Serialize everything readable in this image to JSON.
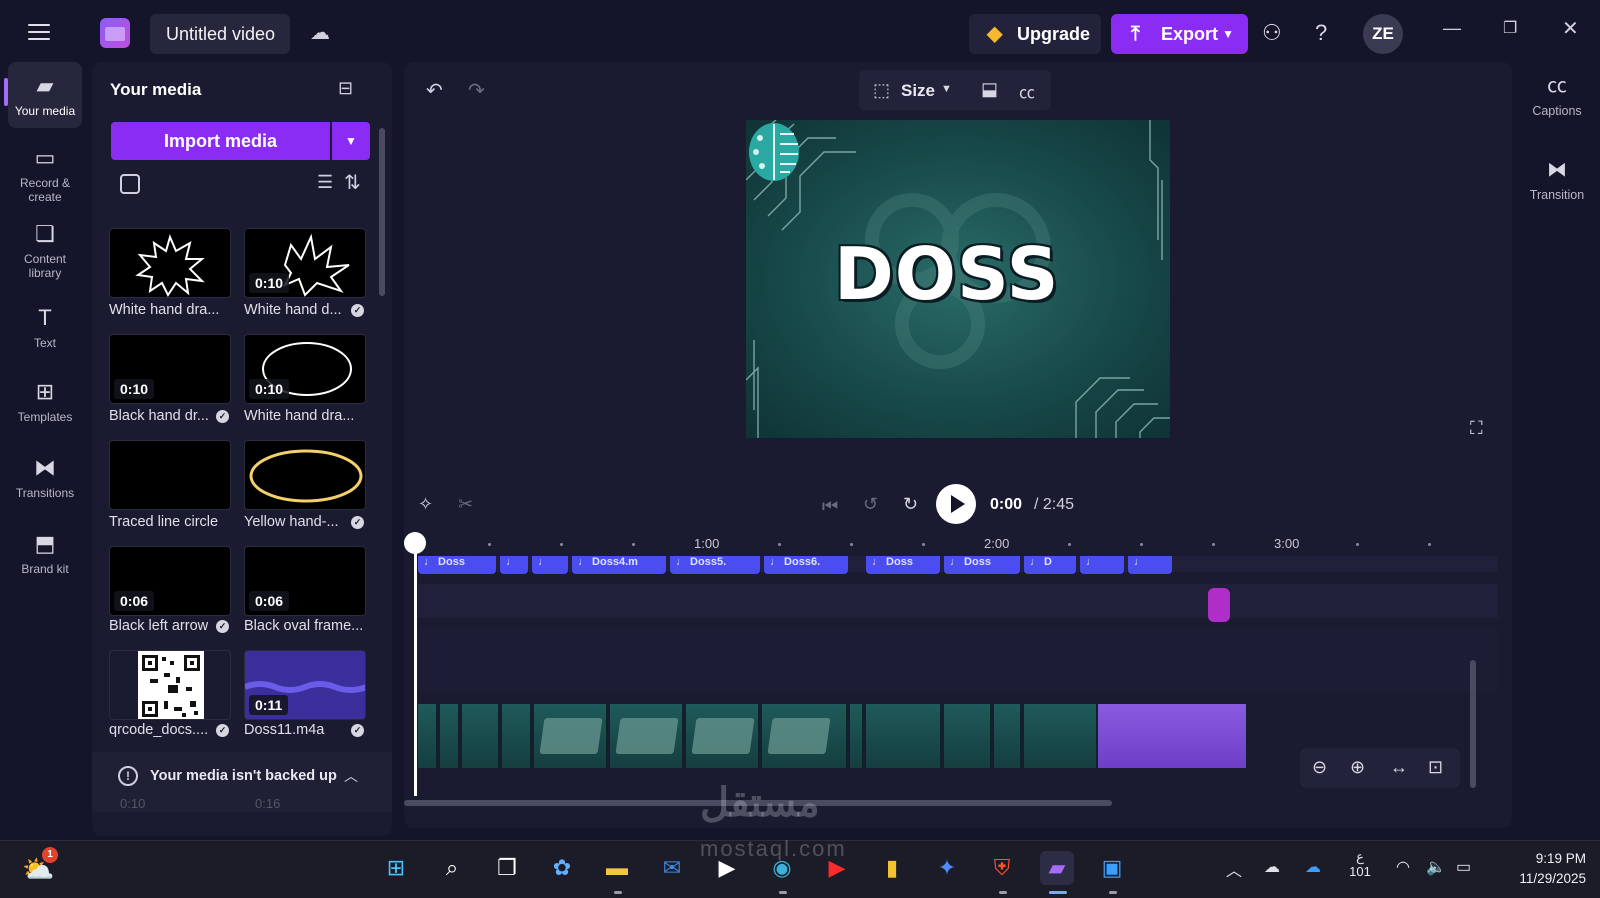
{
  "header": {
    "title": "Untitled video",
    "upgrade_label": "Upgrade",
    "export_label": "Export",
    "avatar_initials": "ZE",
    "accent_color": "#8b2cf5"
  },
  "left_nav": {
    "items": [
      {
        "label": "Your media",
        "icon": "folder-icon",
        "active": true
      },
      {
        "label": "Record & create",
        "icon": "camera-icon"
      },
      {
        "label": "Content library",
        "icon": "library-icon"
      },
      {
        "label": "Text",
        "icon": "text-icon"
      },
      {
        "label": "Templates",
        "icon": "templates-icon"
      },
      {
        "label": "Transitions",
        "icon": "transitions-icon"
      },
      {
        "label": "Brand kit",
        "icon": "brand-kit-icon"
      }
    ]
  },
  "media_panel": {
    "title": "Your media",
    "import_label": "Import media",
    "items": [
      {
        "label": "White hand dra...",
        "duration": "",
        "checked": false
      },
      {
        "label": "White hand d...",
        "duration": "0:10",
        "checked": true
      },
      {
        "label": "Black hand dr...",
        "duration": "0:10",
        "checked": true
      },
      {
        "label": "White hand dra...",
        "duration": "0:10",
        "checked": false
      },
      {
        "label": "Traced line circle",
        "duration": "",
        "checked": false
      },
      {
        "label": "Yellow hand-...",
        "duration": "",
        "checked": true
      },
      {
        "label": "Black left arrow",
        "duration": "0:06",
        "checked": true
      },
      {
        "label": "Black oval frame...",
        "duration": "0:06",
        "checked": false
      },
      {
        "label": "qrcode_docs....",
        "duration": "",
        "checked": true
      },
      {
        "label": "Doss11.m4a",
        "duration": "0:11",
        "checked": true
      }
    ],
    "backup_notice": "Your media isn't backed up",
    "hidden_durations": [
      "0:10",
      "0:16"
    ]
  },
  "editor": {
    "size_label": "Size",
    "preview_title": "DOSS",
    "current_time": "0:00",
    "total_time": "/ 2:45"
  },
  "timeline": {
    "ruler": [
      "1:00",
      "2:00",
      "3:00"
    ],
    "audio_clips": [
      {
        "label": "♩ Doss"
      },
      {
        "label": "♩"
      },
      {
        "label": "♩"
      },
      {
        "label": "♩ Doss4.m"
      },
      {
        "label": "♩ Doss5."
      },
      {
        "label": "♩ Doss6."
      },
      {
        "label": "♩ Doss"
      },
      {
        "label": "♩ Doss"
      },
      {
        "label": "♩ D"
      },
      {
        "label": "♩"
      },
      {
        "label": "♩"
      }
    ]
  },
  "right_rail": {
    "items": [
      {
        "label": "Captions",
        "icon": "captions-icon"
      },
      {
        "label": "Transition",
        "icon": "transition-icon"
      }
    ]
  },
  "taskbar": {
    "notification_count": "1",
    "language": "ع",
    "language_sub": "101",
    "time": "9:19 PM",
    "date": "11/29/2025"
  },
  "watermark": {
    "text": "مستقل",
    "sub": "mostaql.com"
  }
}
